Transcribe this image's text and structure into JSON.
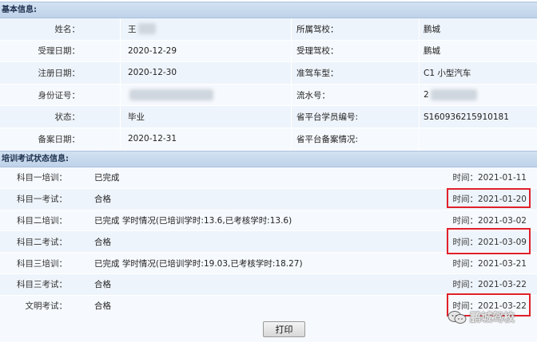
{
  "basic": {
    "header": "基本信息:",
    "rows": [
      {
        "l1": "姓名：",
        "v1": "王",
        "l2": "所属驾校：",
        "v2": "鹏城"
      },
      {
        "l1": "受理日期：",
        "v1": "2020-12-29",
        "l2": "受理驾校：",
        "v2": "鹏城"
      },
      {
        "l1": "注册日期：",
        "v1": "2020-12-30",
        "l2": "准驾车型：",
        "v2": "C1 小型汽车"
      },
      {
        "l1": "身份证号：",
        "v1": "",
        "l2": "流水号：",
        "v2": "2"
      },
      {
        "l1": "状态：",
        "v1": "毕业",
        "l2": "省平台学员编号:",
        "v2": "S160936215910181"
      },
      {
        "l1": "备案日期：",
        "v1": "2020-12-31",
        "l2": "省平台备案情况:",
        "v2": ""
      }
    ]
  },
  "training": {
    "header": "培训考试状态信息:",
    "rows": [
      {
        "label": "科目一培训：",
        "status": "已完成",
        "time": "时间：2021-01-11"
      },
      {
        "label": "科目一考试：",
        "status": "合格",
        "time": "时间：2021-01-20"
      },
      {
        "label": "科目二培训：",
        "status": "已完成 学时情况(已培训学时:13.6,已考核学时:13.6)",
        "time": "时间：2021-03-02"
      },
      {
        "label": "科目二考试：",
        "status": "合格",
        "time": "时间：2021-03-09"
      },
      {
        "label": "科目三培训：",
        "status": "已完成 学时情况(已培训学时:19.03,已考核学时:18.27)",
        "time": "时间：2021-03-21"
      },
      {
        "label": "科目三考试：",
        "status": "合格",
        "time": "时间：2021-03-22"
      },
      {
        "label": "文明考试：",
        "status": "合格",
        "time": "时间：2021-03-22"
      }
    ]
  },
  "print_label": "打印",
  "watermark_text": "鹏城驾校",
  "colors": {
    "header_bg": "#c6d8ec",
    "row_alt": "#eef4fb",
    "highlight": "#e0202a"
  }
}
